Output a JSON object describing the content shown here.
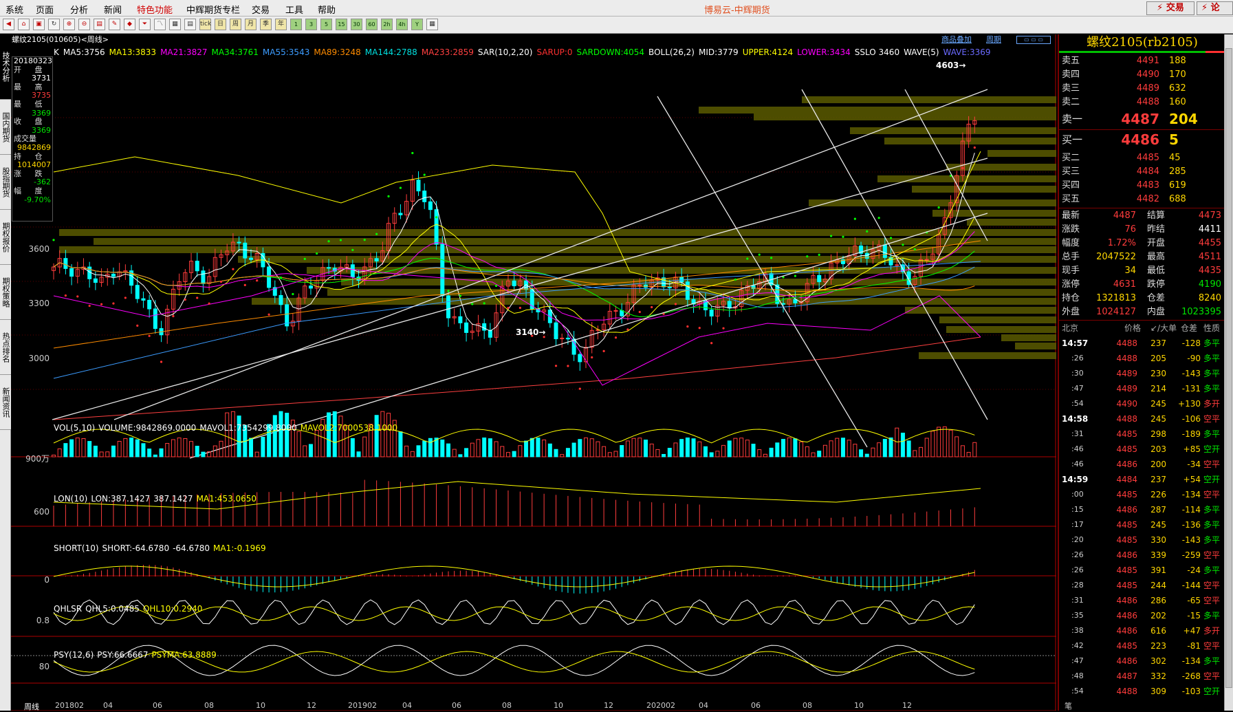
{
  "menu": {
    "items": [
      "系统",
      "页面",
      "分析",
      "新闻",
      "特色功能",
      "中辉期货专栏",
      "交易",
      "工具",
      "帮助"
    ],
    "title": "博易云-中辉期货",
    "trade": "⚡ 交易",
    "discuss": "⚡ 论"
  },
  "toolbar": {
    "icons": [
      "back-icon",
      "home-icon",
      "open-icon",
      "refresh-icon",
      "zoom-in-icon",
      "zoom-out-icon",
      "save-icon",
      "draw-icon",
      "paint-icon",
      "filter-icon",
      "chart-icon",
      "table-icon",
      "list-icon",
      "tick-icon",
      "day-icon",
      "week-icon",
      "month-icon",
      "season-icon",
      "year-icon",
      "1min-icon",
      "3min-icon",
      "5min-icon",
      "15min-icon",
      "30min-icon",
      "60min-icon",
      "2h-icon",
      "4h-icon",
      "multiday-icon",
      "calc-icon"
    ],
    "labels": [
      "◀",
      "⌂",
      "▣",
      "↻",
      "⊕",
      "⊖",
      "▤",
      "✎",
      "◆",
      "⏷",
      "〽",
      "▦",
      "▤",
      "tick",
      "日",
      "周",
      "月",
      "季",
      "年",
      "1",
      "3",
      "5",
      "15",
      "30",
      "60",
      "2h",
      "4h",
      "Y",
      "▦"
    ]
  },
  "left_tabs": [
    "技术分析",
    "国内期货",
    "股指期货",
    "期权报价",
    "期权策略",
    "热点排名",
    "新闻资讯"
  ],
  "chart": {
    "title": "螺纹2105(010605)<周线>",
    "links": [
      "商品叠加",
      "周期"
    ],
    "ohlc": {
      "date": "20180323",
      "open_label": "开 盘",
      "open": "3731",
      "high_label": "最 高",
      "high": "3735",
      "low_label": "最 低",
      "low": "3369",
      "close_label": "收 盘",
      "close": "3369",
      "vol_label": "成交量",
      "vol": "9842869",
      "oi_label": "持 仓",
      "oi": "1014007",
      "chg_label": "涨 跌",
      "chg": "-362",
      "pct_label": "幅 度",
      "pct": "-9.70%"
    },
    "indicators": [
      {
        "t": "K",
        "c": "#ffffff"
      },
      {
        "t": "MA5:3756",
        "c": "#ffffff"
      },
      {
        "t": "MA13:3833",
        "c": "#ffff00"
      },
      {
        "t": "MA21:3827",
        "c": "#ff00ff"
      },
      {
        "t": "MA34:3761",
        "c": "#00ff00"
      },
      {
        "t": "MA55:3543",
        "c": "#3c9cff"
      },
      {
        "t": "MA89:3248",
        "c": "#ff8c00"
      },
      {
        "t": "MA144:2788",
        "c": "#00e0e0"
      },
      {
        "t": "MA233:2859",
        "c": "#ff4040"
      },
      {
        "t": "SAR(10,2,20)",
        "c": "#ffffff"
      },
      {
        "t": "SARUP:0",
        "c": "#ff3030"
      },
      {
        "t": "SARDOWN:4054",
        "c": "#00ff00"
      },
      {
        "t": "BOLL(26,2)",
        "c": "#ffffff"
      },
      {
        "t": "MID:3779",
        "c": "#ffffff"
      },
      {
        "t": "UPPER:4124",
        "c": "#ffff00"
      },
      {
        "t": "LOWER:3434",
        "c": "#ff00ff"
      },
      {
        "t": "SSLO 3460",
        "c": "#ffffff"
      },
      {
        "t": "WAVE(5)",
        "c": "#ffffff"
      },
      {
        "t": "WAVE:3369",
        "c": "#6a6aff"
      }
    ],
    "yticks": [
      "3600",
      "3300",
      "3000"
    ],
    "annot_high": "4603→",
    "annot_low": "3140→",
    "vol": {
      "labels": [
        {
          "t": "VOL(5,10)",
          "c": "#ffffff"
        },
        {
          "t": "VOLUME:9842869.0000",
          "c": "#ffffff"
        },
        {
          "t": "MAVOL1:7354299.8000",
          "c": "#ffffff"
        },
        {
          "t": "MAVOL2:7000538.1000",
          "c": "#ffff00"
        }
      ],
      "ytick": "900万"
    },
    "lon": {
      "labels": [
        {
          "t": "LON(10)",
          "c": "#ffffff"
        },
        {
          "t": "LON:387.1427",
          "c": "#ffffff"
        },
        {
          "t": "387.1427",
          "c": "#ffffff"
        },
        {
          "t": "MA1:453.0650",
          "c": "#ffff00"
        }
      ],
      "ytick": "600"
    },
    "short": {
      "labels": [
        {
          "t": "SHORT(10)",
          "c": "#ffffff"
        },
        {
          "t": "SHORT:-64.6780",
          "c": "#ffffff"
        },
        {
          "t": "-64.6780",
          "c": "#ffffff"
        },
        {
          "t": "MA1:-0.1969",
          "c": "#ffff00"
        }
      ],
      "ytick": "0"
    },
    "qhl": {
      "labels": [
        {
          "t": "QHLSR",
          "c": "#ffffff"
        },
        {
          "t": "QHL5:0.0485",
          "c": "#ffffff"
        },
        {
          "t": "QHL10:0.2940",
          "c": "#ffff00"
        }
      ],
      "ytick": "0.8"
    },
    "psy": {
      "labels": [
        {
          "t": "PSY(12,6)",
          "c": "#ffffff"
        },
        {
          "t": "PSY:66.6667",
          "c": "#ffffff"
        },
        {
          "t": "PSYMA:63.8889",
          "c": "#ffff00"
        }
      ],
      "ytick": "80"
    },
    "xticks": [
      "201802",
      "04",
      "06",
      "08",
      "10",
      "12",
      "201902",
      "04",
      "06",
      "08",
      "10",
      "12",
      "202002",
      "04",
      "06",
      "08",
      "10",
      "12"
    ],
    "period": "周线"
  },
  "quote": {
    "title": "螺纹2105(rb2105)",
    "asks": [
      {
        "k": "卖五",
        "p": "4491",
        "v": "188"
      },
      {
        "k": "卖四",
        "p": "4490",
        "v": "170"
      },
      {
        "k": "卖三",
        "p": "4489",
        "v": "632"
      },
      {
        "k": "卖二",
        "p": "4488",
        "v": "160"
      },
      {
        "k": "卖一",
        "p": "4487",
        "v": "204"
      }
    ],
    "bids": [
      {
        "k": "买一",
        "p": "4486",
        "v": "5"
      },
      {
        "k": "买二",
        "p": "4485",
        "v": "45"
      },
      {
        "k": "买三",
        "p": "4484",
        "v": "285"
      },
      {
        "k": "买四",
        "p": "4483",
        "v": "619"
      },
      {
        "k": "买五",
        "p": "4482",
        "v": "688"
      }
    ],
    "stats": [
      {
        "k": "最新",
        "v": "4487",
        "c": "red",
        "k2": "结算",
        "v2": "4473",
        "c2": "red"
      },
      {
        "k": "涨跌",
        "v": "76",
        "c": "red",
        "k2": "昨结",
        "v2": "4411",
        "c2": "wht"
      },
      {
        "k": "幅度",
        "v": "1.72%",
        "c": "red",
        "k2": "开盘",
        "v2": "4455",
        "c2": "red"
      },
      {
        "k": "总手",
        "v": "2047522",
        "c": "yel",
        "k2": "最高",
        "v2": "4511",
        "c2": "red"
      },
      {
        "k": "现手",
        "v": "34",
        "c": "yel",
        "k2": "最低",
        "v2": "4435",
        "c2": "red"
      },
      {
        "k": "涨停",
        "v": "4631",
        "c": "red",
        "k2": "跌停",
        "v2": "4190",
        "c2": "grn"
      },
      {
        "k": "持仓",
        "v": "1321813",
        "c": "yel",
        "k2": "仓差",
        "v2": "8240",
        "c2": "yel"
      },
      {
        "k": "外盘",
        "v": "1024127",
        "c": "red",
        "k2": "内盘",
        "v2": "1023395",
        "c2": "grn"
      }
    ],
    "tick_header": {
      "time": "北京",
      "price": "价格",
      "vol": "↙/大单",
      "diff": "仓差",
      "nature": "性质"
    },
    "ticks": [
      {
        "t": "14:57",
        "p": "4488",
        "v": "237",
        "d": "-128",
        "n": "多平",
        "nc": "grn",
        "major": true
      },
      {
        "t": ":26",
        "p": "4488",
        "v": "205",
        "d": "-90",
        "n": "多平",
        "nc": "grn"
      },
      {
        "t": ":30",
        "p": "4489",
        "v": "230",
        "d": "-143",
        "n": "多平",
        "nc": "grn"
      },
      {
        "t": ":47",
        "p": "4489",
        "v": "214",
        "d": "-131",
        "n": "多平",
        "nc": "grn"
      },
      {
        "t": ":54",
        "p": "4490",
        "v": "245",
        "d": "+130",
        "n": "多开",
        "nc": "red"
      },
      {
        "t": "14:58",
        "p": "4488",
        "v": "245",
        "d": "-106",
        "n": "空平",
        "nc": "red",
        "major": true
      },
      {
        "t": ":31",
        "p": "4485",
        "v": "298",
        "d": "-189",
        "n": "多平",
        "nc": "grn"
      },
      {
        "t": ":46",
        "p": "4485",
        "v": "203",
        "d": "+85",
        "n": "空开",
        "nc": "grn"
      },
      {
        "t": ":46",
        "p": "4486",
        "v": "200",
        "d": "-34",
        "n": "空平",
        "nc": "red"
      },
      {
        "t": "14:59",
        "p": "4484",
        "v": "237",
        "d": "+54",
        "n": "空开",
        "nc": "grn",
        "major": true
      },
      {
        "t": ":00",
        "p": "4485",
        "v": "226",
        "d": "-134",
        "n": "空平",
        "nc": "red"
      },
      {
        "t": ":15",
        "p": "4486",
        "v": "287",
        "d": "-114",
        "n": "多平",
        "nc": "grn"
      },
      {
        "t": ":17",
        "p": "4485",
        "v": "245",
        "d": "-136",
        "n": "多平",
        "nc": "grn"
      },
      {
        "t": ":20",
        "p": "4485",
        "v": "330",
        "d": "-143",
        "n": "多平",
        "nc": "grn"
      },
      {
        "t": ":26",
        "p": "4486",
        "v": "339",
        "d": "-259",
        "n": "空平",
        "nc": "red"
      },
      {
        "t": ":26",
        "p": "4485",
        "v": "391",
        "d": "-24",
        "n": "多平",
        "nc": "grn"
      },
      {
        "t": ":28",
        "p": "4485",
        "v": "244",
        "d": "-144",
        "n": "空平",
        "nc": "red"
      },
      {
        "t": ":31",
        "p": "4486",
        "v": "286",
        "d": "-65",
        "n": "空平",
        "nc": "red"
      },
      {
        "t": ":35",
        "p": "4486",
        "v": "202",
        "d": "-15",
        "n": "多平",
        "nc": "grn"
      },
      {
        "t": ":38",
        "p": "4486",
        "v": "616",
        "d": "+47",
        "n": "多开",
        "nc": "red"
      },
      {
        "t": ":42",
        "p": "4485",
        "v": "223",
        "d": "-81",
        "n": "空平",
        "nc": "red"
      },
      {
        "t": ":47",
        "p": "4486",
        "v": "302",
        "d": "-134",
        "n": "多平",
        "nc": "grn"
      },
      {
        "t": ":48",
        "p": "4487",
        "v": "332",
        "d": "-268",
        "n": "空平",
        "nc": "red"
      },
      {
        "t": ":54",
        "p": "4488",
        "v": "309",
        "d": "-103",
        "n": "空开",
        "nc": "grn"
      }
    ],
    "footer": "笔"
  }
}
